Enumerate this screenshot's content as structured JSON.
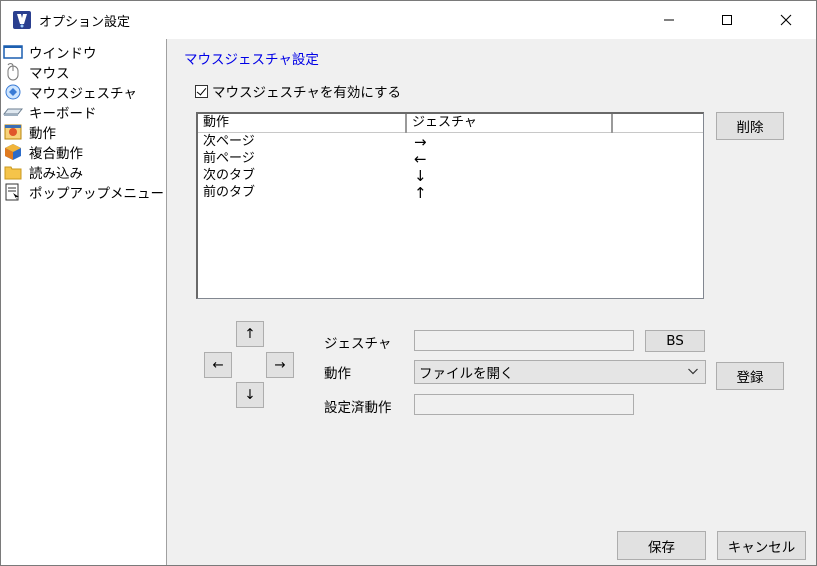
{
  "window": {
    "title": "オプション設定",
    "controls": {
      "minimize": "—",
      "maximize": "☐",
      "close": "✕"
    }
  },
  "sidebar": {
    "items": [
      {
        "label": "ウインドウ",
        "icon": "window-icon"
      },
      {
        "label": "マウス",
        "icon": "mouse-icon"
      },
      {
        "label": "マウスジェスチャ",
        "icon": "gesture-icon"
      },
      {
        "label": "キーボード",
        "icon": "keyboard-icon"
      },
      {
        "label": "動作",
        "icon": "action-icon"
      },
      {
        "label": "複合動作",
        "icon": "compound-action-icon"
      },
      {
        "label": "読み込み",
        "icon": "folder-icon"
      },
      {
        "label": "ポップアップメニュー",
        "icon": "popup-menu-icon"
      }
    ]
  },
  "main": {
    "section_title": "マウスジェスチャ設定",
    "enable_checkbox": {
      "label": "マウスジェスチャを有効にする",
      "checked": true
    },
    "table": {
      "columns": [
        "動作",
        "ジェスチャ",
        ""
      ],
      "rows": [
        {
          "action": "次ページ",
          "gesture": "→"
        },
        {
          "action": "前ページ",
          "gesture": "←"
        },
        {
          "action": "次のタブ",
          "gesture": "↓"
        },
        {
          "action": "前のタブ",
          "gesture": "↑"
        }
      ]
    },
    "delete_button": "削除",
    "pad": {
      "up": "↑",
      "left": "←",
      "right": "→",
      "down": "↓"
    },
    "gesture_label": "ジェスチャ",
    "gesture_value": "",
    "bs_button": "BS",
    "action_label": "動作",
    "action_selected": "ファイルを開く",
    "register_button": "登録",
    "assigned_label": "設定済動作",
    "assigned_value": ""
  },
  "footer": {
    "save_button": "保存",
    "cancel_button": "キャンセル"
  }
}
